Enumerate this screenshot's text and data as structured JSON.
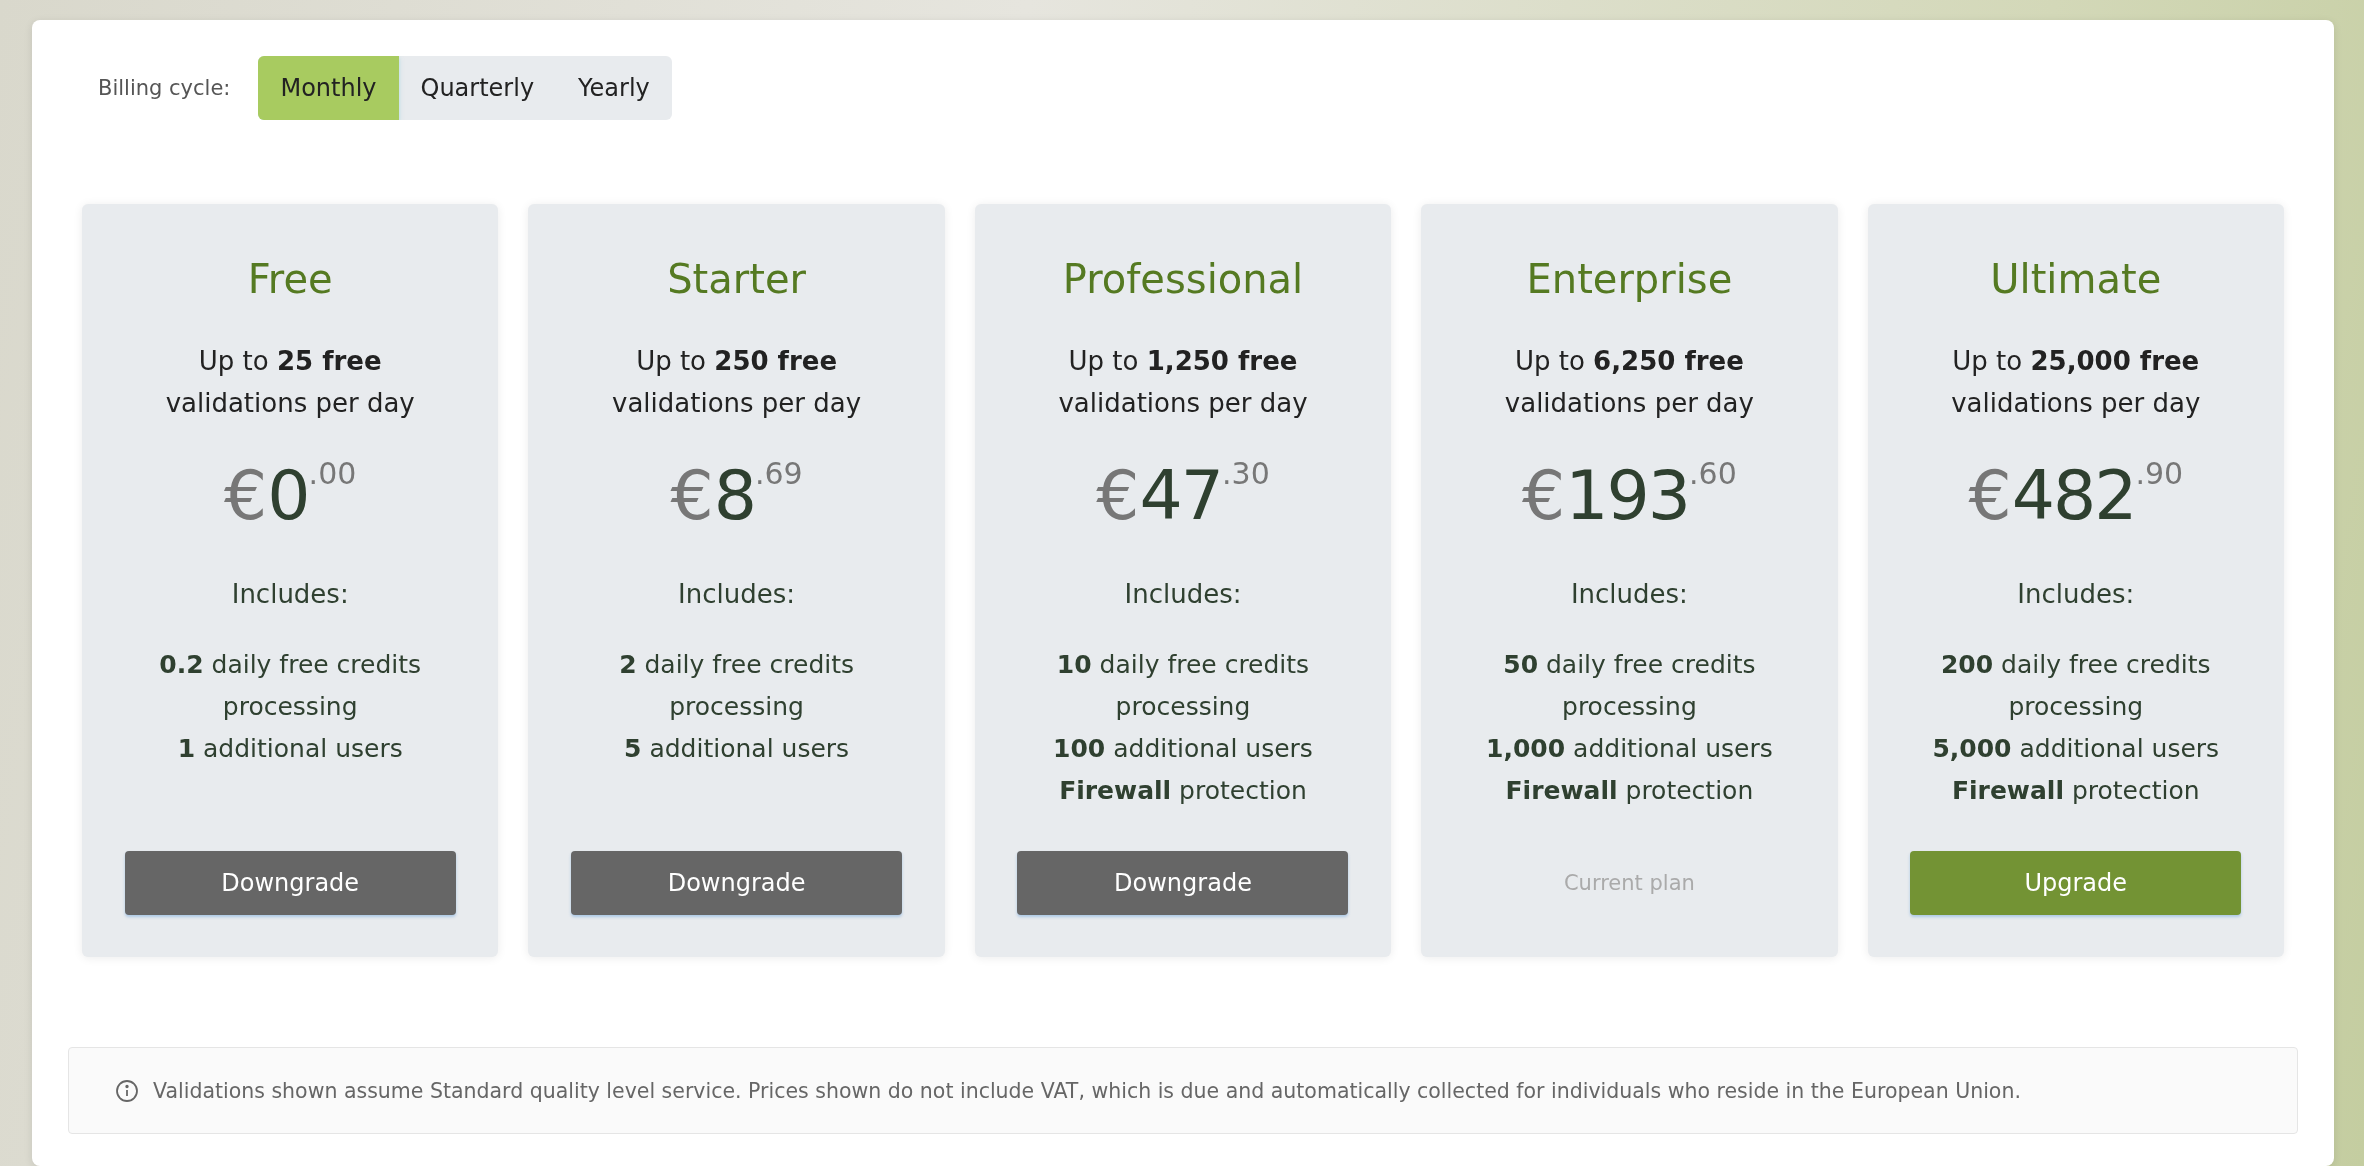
{
  "billing": {
    "label": "Billing cycle:",
    "options": [
      {
        "label": "Monthly",
        "selected": true
      },
      {
        "label": "Quarterly",
        "selected": false
      },
      {
        "label": "Yearly",
        "selected": false
      }
    ]
  },
  "plans": [
    {
      "name": "Free",
      "allowance": "Up to **25 free**\nvalidations per day",
      "price": {
        "currency": "€",
        "whole": "0",
        "cents": ".00"
      },
      "includes": "Includes:",
      "features": [
        "**0.2** daily free credits processing",
        "**1** additional users"
      ],
      "action": {
        "kind": "downgrade",
        "label": "Downgrade"
      }
    },
    {
      "name": "Starter",
      "allowance": "Up to **250 free**\nvalidations per day",
      "price": {
        "currency": "€",
        "whole": "8",
        "cents": ".69"
      },
      "includes": "Includes:",
      "features": [
        "**2** daily free credits processing",
        "**5** additional users"
      ],
      "action": {
        "kind": "downgrade",
        "label": "Downgrade"
      }
    },
    {
      "name": "Professional",
      "allowance": "Up to **1,250 free**\nvalidations per day",
      "price": {
        "currency": "€",
        "whole": "47",
        "cents": ".30"
      },
      "includes": "Includes:",
      "features": [
        "**10** daily free credits processing",
        "**100** additional users",
        "**Firewall** protection"
      ],
      "action": {
        "kind": "downgrade",
        "label": "Downgrade"
      }
    },
    {
      "name": "Enterprise",
      "allowance": "Up to **6,250 free**\nvalidations per day",
      "price": {
        "currency": "€",
        "whole": "193",
        "cents": ".60"
      },
      "includes": "Includes:",
      "features": [
        "**50** daily free credits processing",
        "**1,000** additional users",
        "**Firewall** protection"
      ],
      "action": {
        "kind": "current",
        "label": "Current plan"
      }
    },
    {
      "name": "Ultimate",
      "allowance": "Up to **25,000 free**\nvalidations per day",
      "price": {
        "currency": "€",
        "whole": "482",
        "cents": ".90"
      },
      "includes": "Includes:",
      "features": [
        "**200** daily free credits processing",
        "**5,000** additional users",
        "**Firewall** protection"
      ],
      "action": {
        "kind": "upgrade",
        "label": "Upgrade"
      }
    }
  ],
  "note": "Validations shown assume Standard quality level service. Prices shown do not include VAT, which is due and automatically collected for individuals who reside in the European Union."
}
